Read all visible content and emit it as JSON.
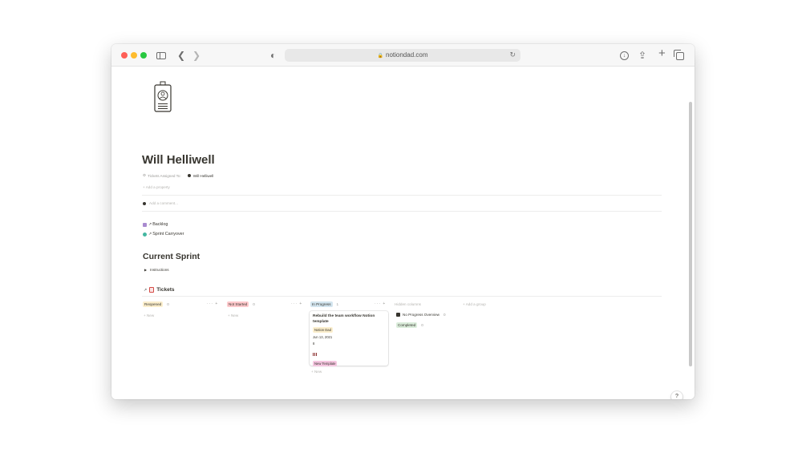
{
  "browser": {
    "url": "notiondad.com"
  },
  "page": {
    "title": "Will Helliwell",
    "property_label": "Tickets Assigned To",
    "property_value": "Will Helliwell",
    "add_property": "Add a property",
    "add_comment": "Add a comment..."
  },
  "links": [
    {
      "label": "Backlog"
    },
    {
      "label": "Sprint Carryover"
    }
  ],
  "sprint": {
    "heading": "Current Sprint",
    "toggle_label": "Instructions"
  },
  "board": {
    "title": "Tickets",
    "columns": [
      {
        "label": "Reopened",
        "count": "0",
        "new": "New"
      },
      {
        "label": "Not Started",
        "count": "0",
        "new": "New"
      },
      {
        "label": "In Progress",
        "count": "1",
        "new": "New"
      }
    ],
    "hidden_columns_label": "Hidden columns",
    "add_group": "Add a group",
    "hidden_items": [
      {
        "label": "No Progress Overview",
        "count": "0"
      },
      {
        "label": "Completed",
        "count": "0"
      }
    ],
    "card": {
      "title": "Rebuild the team workflow Notion template",
      "tag": "Notion Dad",
      "date": "Jun 13, 2021",
      "number": "8",
      "type_tag": "New Template"
    }
  },
  "help": "?",
  "colors": {
    "reopened": "#fbeecc",
    "not_started": "#ffc9cc",
    "in_progress": "#d3e5ef",
    "completed": "#dbeddb",
    "new_template": "#f5c6e0"
  }
}
